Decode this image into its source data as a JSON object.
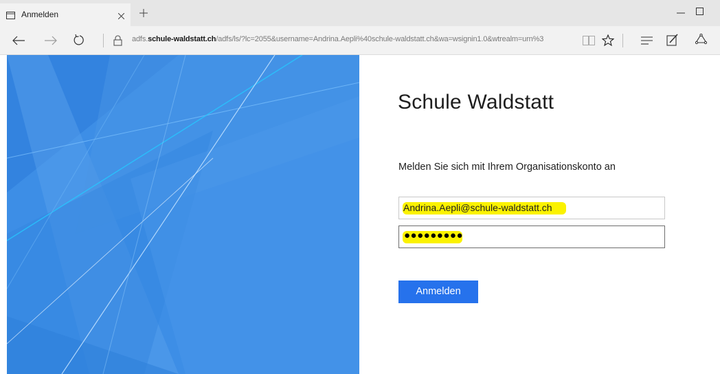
{
  "browser": {
    "tab": {
      "title": "Anmelden"
    },
    "address": {
      "prefix": "adfs.",
      "domain": "schule-waldstatt.ch",
      "path": "/adfs/ls/?lc=2055&username=Andrina.Aepli%40schule-waldstatt.ch&wa=wsignin1.0&wtrealm=urn%3"
    },
    "icons": {
      "tab": "tab-page-icon",
      "close": "close-icon",
      "new_tab": "plus-icon",
      "minimize": "minimize-icon",
      "maximize": "maximize-icon",
      "back": "back-arrow-icon",
      "forward": "forward-arrow-icon",
      "refresh": "refresh-icon",
      "lock": "lock-icon",
      "reading_view": "book-icon",
      "favorite": "star-icon",
      "hub": "hub-icon",
      "web_note": "pen-icon",
      "share": "share-icon"
    }
  },
  "login": {
    "org_name": "Schule Waldstatt",
    "prompt": "Melden Sie sich mit Ihrem Organisationskonto an",
    "username_value": "Andrina.Aepli@schule-waldstatt.ch",
    "password_mask": "●●●●●●●●●",
    "submit_label": "Anmelden"
  },
  "colors": {
    "accent": "#2672ec",
    "highlight": "#fbf200",
    "art_background": "#3d8ee6"
  }
}
